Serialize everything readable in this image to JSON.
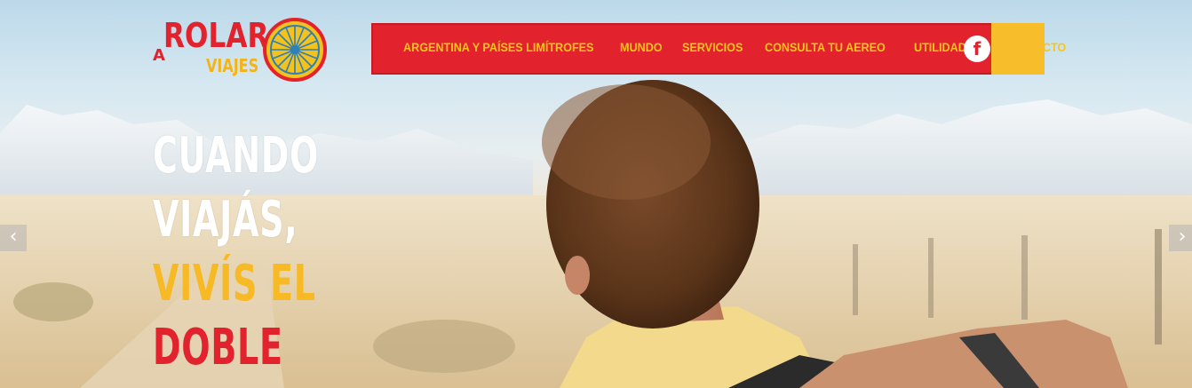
{
  "brand": {
    "logo_a": "A",
    "logo_rolar": "ROLAR",
    "logo_viajes": "VIAJES",
    "colors": {
      "red": "#e2232d",
      "yellow": "#f7bd2a",
      "white": "#ffffff"
    }
  },
  "nav": {
    "items": [
      {
        "label": "ARGENTINA Y PAÍSES LIMÍTROFES"
      },
      {
        "label": "MUNDO"
      },
      {
        "label": "SERVICIOS"
      },
      {
        "label": "CONSULTA TU AEREO"
      },
      {
        "label": "UTILIDADES"
      },
      {
        "label": "CONTACTO"
      }
    ],
    "facebook_icon": "f"
  },
  "hero": {
    "line1": "CUANDO",
    "line2": "VIAJÁS,",
    "line3": "VIVÍS EL",
    "line4": "DOBLE"
  },
  "slider": {
    "prev_icon": "‹",
    "next_icon": "›"
  }
}
